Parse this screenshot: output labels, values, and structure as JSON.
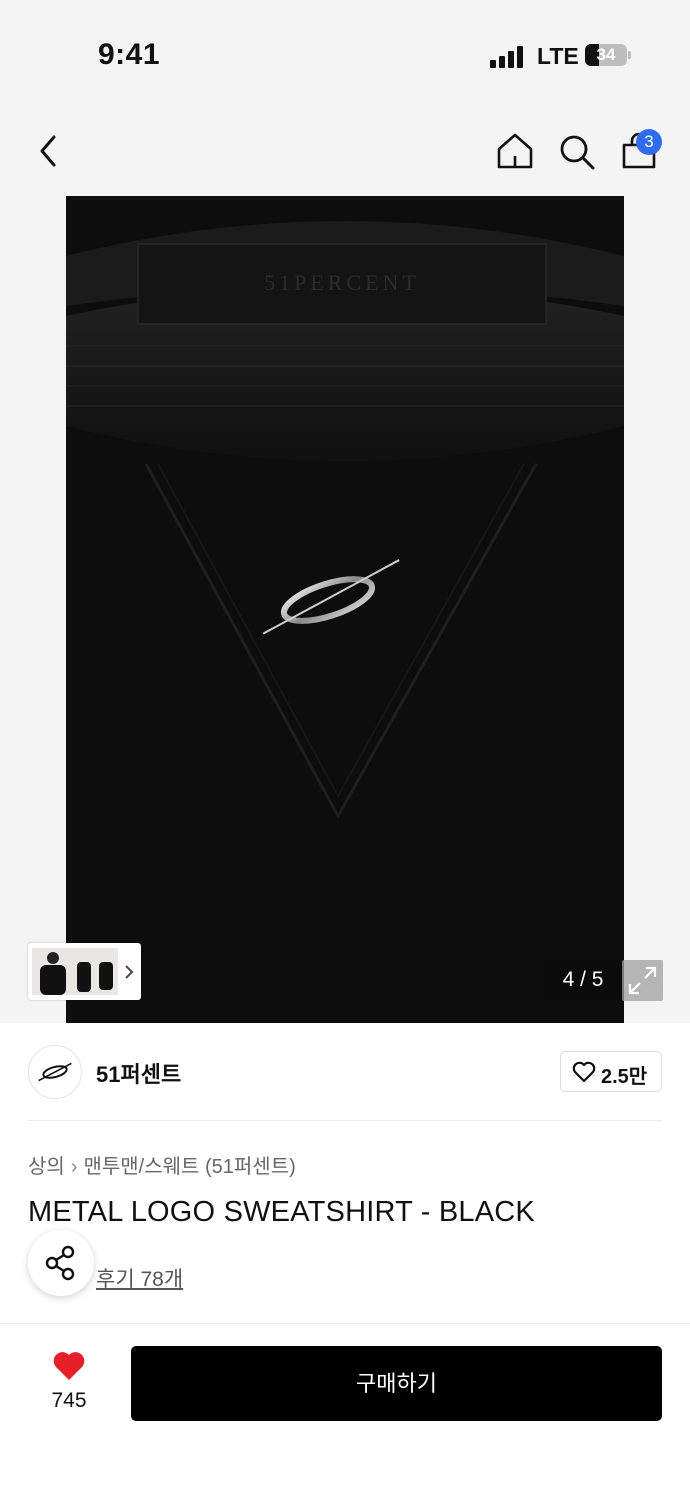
{
  "status_bar": {
    "time": "9:41",
    "network": "LTE",
    "battery": "34",
    "battery_level": 0.34
  },
  "header": {
    "cart_count": "3",
    "icons": [
      "back-icon",
      "home-icon",
      "search-icon",
      "cart-icon"
    ]
  },
  "product": {
    "image_counter": "4 / 5",
    "brand_name": "51퍼센트",
    "brand_likes": "2.5만",
    "breadcrumb": {
      "category": "상의",
      "sub_category": "맨투맨/스웨트 (51퍼센트)"
    },
    "title": "METAL LOGO SWEATSHIRT - BLACK",
    "review_link": "후기 78개",
    "label_text": "51PERCENT"
  },
  "bottom_bar": {
    "wish_count": "745",
    "buy_label": "구매하기"
  },
  "colors": {
    "accent_blue": "#2f6bf2",
    "heart_red": "#e5202a",
    "button_black": "#000000"
  }
}
